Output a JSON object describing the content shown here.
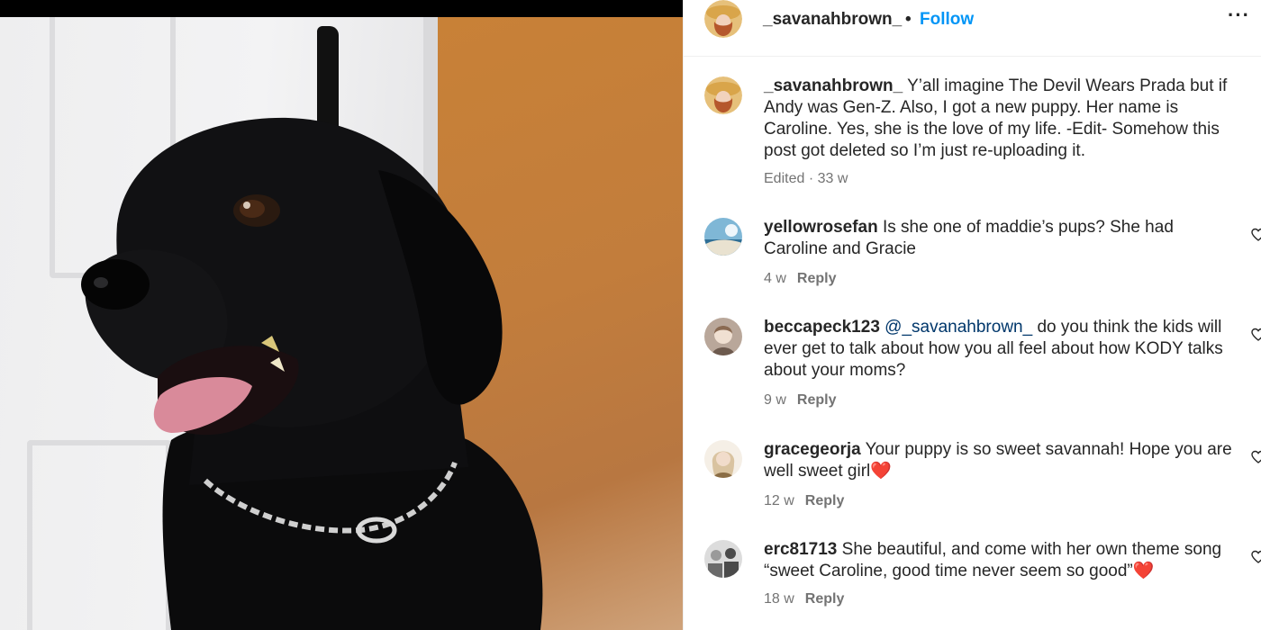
{
  "post": {
    "username": "_savanahbrown_",
    "separator": "•",
    "follow_label": "Follow",
    "more_label": "···",
    "image_alt": "Black Labrador puppy"
  },
  "caption": {
    "username": "_savanahbrown_",
    "text": "Y’all imagine The Devil Wears Prada but if Andy was Gen-Z. Also, I got a new puppy. Her name is Caroline. Yes, she is the love of my life. -Edit- Somehow this post got deleted so I’m just re-uploading it.",
    "meta": "Edited · 33 w"
  },
  "comments": [
    {
      "username": "yellowrosefan",
      "mention": "",
      "text": "Is she one of maddie’s pups? She had Caroline and Gracie",
      "time": "4 w",
      "reply_label": "Reply",
      "avatar_colors": [
        "#7fb7d6",
        "#e9e2d0",
        "#2f6f96"
      ]
    },
    {
      "username": "beccapeck123",
      "mention": "@_savanahbrown_",
      "text": "do you think the kids will ever get to talk about how you all feel about how KODY talks about your moms?",
      "time": "9 w",
      "reply_label": "Reply",
      "avatar_colors": [
        "#b9a79a",
        "#f0e0d2",
        "#6d5a4e"
      ]
    },
    {
      "username": "gracegeorja",
      "mention": "",
      "text": "Your puppy is so sweet savannah! Hope you are well sweet girl❤️",
      "time": "12 w",
      "reply_label": "Reply",
      "avatar_colors": [
        "#d9c3a0",
        "#f5efe6",
        "#8a6d45"
      ]
    },
    {
      "username": "erc81713",
      "mention": "",
      "text": "She beautiful, and come with her own theme song “sweet Caroline, good time never seem so good”❤️",
      "time": "18 w",
      "reply_label": "Reply",
      "avatar_colors": [
        "#9a9a9a",
        "#dcdcdc",
        "#4a4a4a"
      ]
    }
  ],
  "colors": {
    "follow_blue": "#0095f6",
    "mention_blue": "#00376b",
    "meta_gray": "#737373",
    "text": "#262626"
  }
}
